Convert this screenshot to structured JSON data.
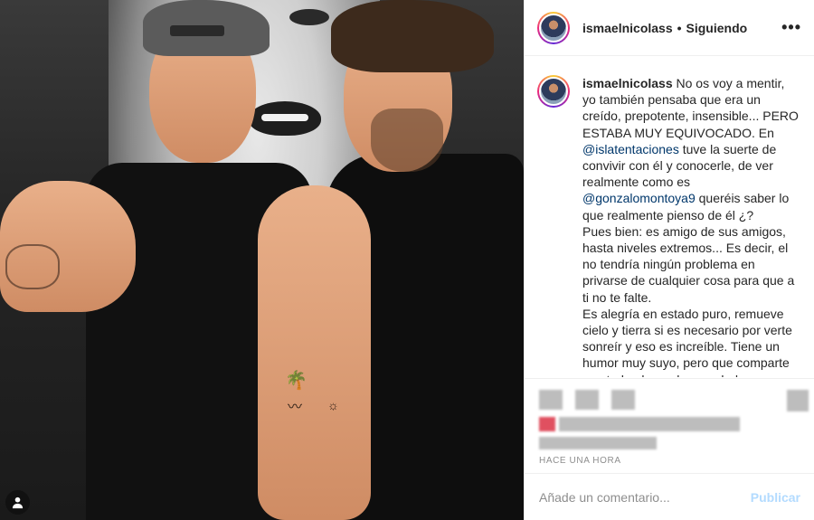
{
  "post": {
    "username": "ismaelnicolass",
    "separator": "•",
    "follow_status": "Siguiendo",
    "more_icon": "more-horizontal-icon",
    "caption": {
      "user": "ismaelnicolass",
      "part1": "No os voy a mentir, yo también pensaba que era un creído, prepotente, insensible... PERO ESTABA MUY EQUIVOCADO. En",
      "mention1": "@islatentaciones",
      "part2": "tuve la suerte de convivir con él y conocerle, de ver realmente como es",
      "mention2": "@gonzalomontoya9",
      "part3": "queréis saber lo que realmente pienso de él ¿?",
      "part4": "Pues bien: es amigo de sus amigos, hasta niveles extremos... Es decir, el no tendría ningún problema en privarse de cualquier cosa para que a ti no te falte.",
      "part5": "Es alegría en estado puro, remueve cielo y tierra si es necesario por verte sonreír y eso es increíble. Tiene un humor muy suyo, pero que comparte con todo el mundo, a su lado es imposible no reírse, porque el se ríe"
    },
    "timestamp": "HACE UNA HORA",
    "comment": {
      "placeholder": "Añade un comentario...",
      "publish_label": "Publicar"
    },
    "colors": {
      "mention": "#00376b",
      "publish": "#b3dbff",
      "muted": "#8e8e8e"
    }
  }
}
